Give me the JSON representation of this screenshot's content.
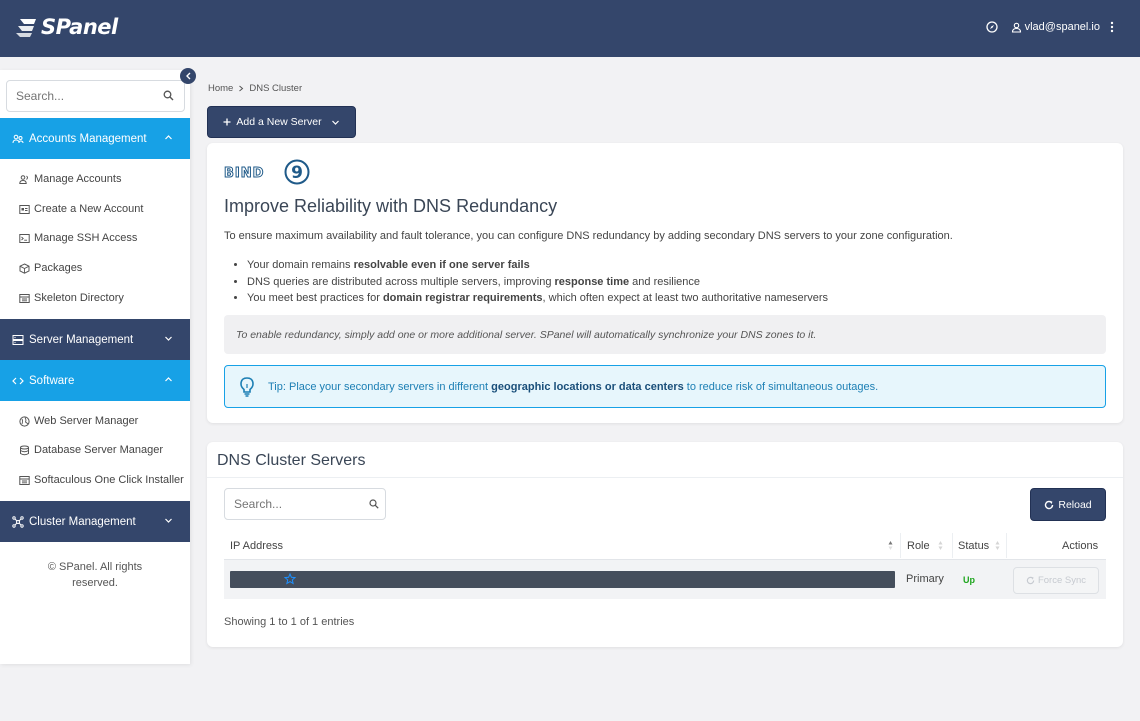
{
  "header": {
    "logo_text": "SPanel",
    "user_email": "vlad@spanel.io"
  },
  "sidebar": {
    "search_placeholder": "Search...",
    "sections": [
      {
        "label": "Accounts Management",
        "state": "expanded",
        "icon": "users-icon"
      },
      {
        "label": "Server Management",
        "state": "collapsed",
        "icon": "server-icon"
      },
      {
        "label": "Software",
        "state": "expanded",
        "icon": "code-icon"
      },
      {
        "label": "Cluster Management",
        "state": "collapsed",
        "icon": "cluster-icon"
      }
    ],
    "accounts_items": [
      {
        "label": "Manage Accounts",
        "icon": "users-icon"
      },
      {
        "label": "Create a New Account",
        "icon": "id-card-icon"
      },
      {
        "label": "Manage SSH Access",
        "icon": "terminal-icon"
      },
      {
        "label": "Packages",
        "icon": "box-icon"
      },
      {
        "label": "Skeleton Directory",
        "icon": "folder-icon"
      }
    ],
    "software_items": [
      {
        "label": "Web Server Manager",
        "icon": "globe-icon"
      },
      {
        "label": "Database Server Manager",
        "icon": "database-icon"
      },
      {
        "label": "Softaculous One Click Installer",
        "icon": "installer-icon"
      }
    ],
    "copyright": "© SPanel. All rights reserved."
  },
  "breadcrumb": {
    "home": "Home",
    "current": "DNS Cluster"
  },
  "add_server_button": "Add a New Server",
  "info_card": {
    "logo_text": "BIND",
    "logo_num": "9",
    "title": "Improve Reliability with DNS Redundancy",
    "description": "To ensure maximum availability and fault tolerance, you can configure DNS redundancy by adding secondary DNS servers to your zone configuration.",
    "bullets": [
      {
        "pre": "Your domain remains ",
        "bold": "resolvable even if one server fails",
        "post": ""
      },
      {
        "pre": "DNS queries are distributed across multiple servers, improving ",
        "bold": "response time",
        "post": " and resilience"
      },
      {
        "pre": "You meet best practices for ",
        "bold": "domain registrar requirements",
        "post": ", which often expect at least two authoritative nameservers"
      }
    ],
    "note": "To enable redundancy, simply add one or more additional server. SPanel will automatically synchronize your DNS zones to it.",
    "tip": {
      "pre": "Tip: Place your secondary servers in different ",
      "bold": "geographic locations or data centers",
      "post": " to reduce risk of simultaneous outages."
    }
  },
  "servers_card": {
    "title": "DNS Cluster Servers",
    "search_placeholder": "Search...",
    "reload_label": "Reload",
    "columns": [
      "IP Address",
      "Role",
      "Status",
      "Actions"
    ],
    "rows": [
      {
        "ip": "",
        "role": "Primary",
        "status": "Up",
        "action": "Force Sync"
      }
    ],
    "footer": "Showing 1 to 1 of 1 entries"
  },
  "colors": {
    "navy": "#34466b",
    "accent_blue": "#17a1e6",
    "status_green": "#1ea51e"
  }
}
